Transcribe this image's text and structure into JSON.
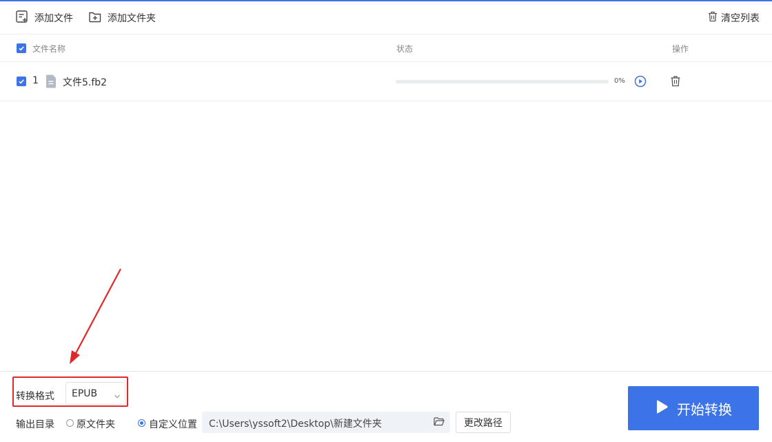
{
  "toolbar": {
    "add_file": "添加文件",
    "add_folder": "添加文件夹",
    "clear_list": "清空列表"
  },
  "list": {
    "headers": {
      "name": "文件名称",
      "status": "状态",
      "action": "操作"
    },
    "rows": [
      {
        "index": "1",
        "name": "文件5.fb2",
        "progress": 0,
        "progress_text": "0%"
      }
    ]
  },
  "bottom": {
    "format_label": "转换格式",
    "format_value": "EPUB",
    "output_label": "输出目录",
    "option_original": "原文件夹",
    "option_custom": "自定义位置",
    "selected_option": "custom",
    "output_path": "C:\\Users\\yssoft2\\Desktop\\新建文件夹",
    "change_path": "更改路径",
    "start": "开始转换"
  },
  "colors": {
    "accent": "#3c73e6",
    "annotation": "#e0282a"
  },
  "icons": [
    "add-file-icon",
    "add-folder-icon",
    "trash-icon",
    "check-icon",
    "file-icon",
    "play-icon",
    "delete-icon",
    "chevron-down-icon",
    "folder-open-icon",
    "play-triangle-icon"
  ]
}
